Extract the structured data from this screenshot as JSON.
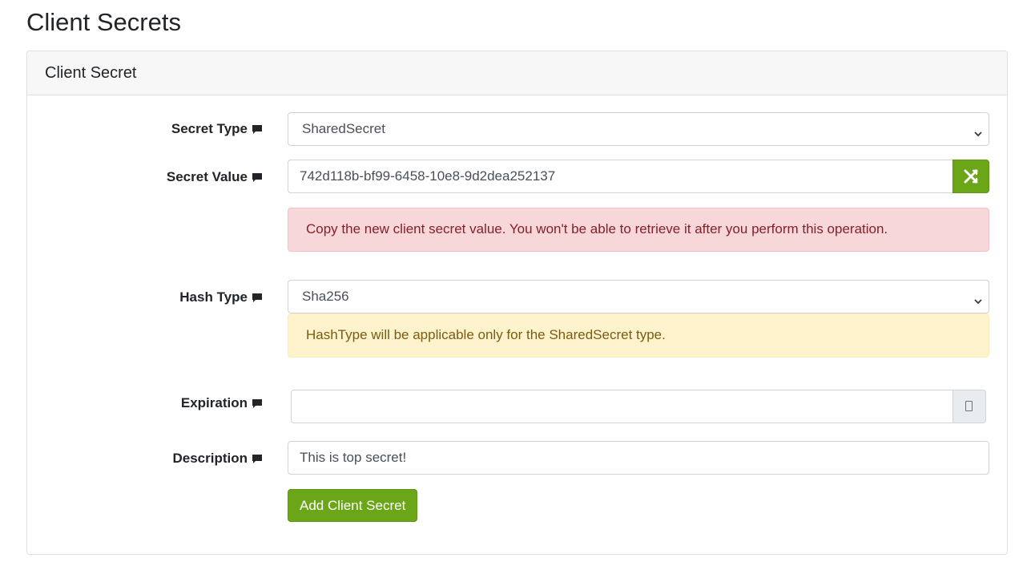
{
  "page": {
    "title": "Client Secrets"
  },
  "card": {
    "title": "Client Secret"
  },
  "form": {
    "secret_type": {
      "label": "Secret Type",
      "value": "SharedSecret"
    },
    "secret_value": {
      "label": "Secret Value",
      "value": "742d118b-bf99-6458-10e8-9d2dea252137",
      "generate_icon": "shuffle-icon"
    },
    "secret_value_alert": "Copy the new client secret value. You won't be able to retrieve it after you perform this operation.",
    "hash_type": {
      "label": "Hash Type",
      "value": "Sha256"
    },
    "hash_type_alert": "HashType will be applicable only for the SharedSecret type.",
    "expiration": {
      "label": "Expiration",
      "value": "",
      "picker_icon": "calendar-icon"
    },
    "description": {
      "label": "Description",
      "value": "This is top secret!"
    },
    "submit_label": "Add Client Secret"
  },
  "icons": {
    "label_help": "comment-icon",
    "select_caret": "chevron-down-icon"
  },
  "colors": {
    "primary": "#6aa618",
    "danger_bg": "#f8d7da",
    "danger_text": "#842029",
    "warning_bg": "#fff3cd",
    "warning_text": "#7a5b12"
  }
}
